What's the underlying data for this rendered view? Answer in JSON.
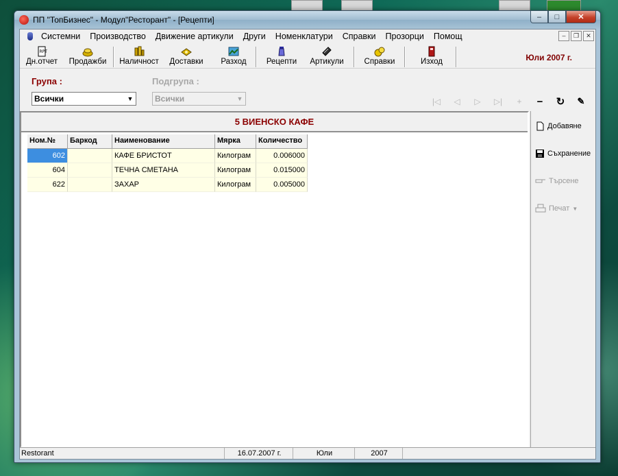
{
  "window": {
    "title": "ПП \"ТопБизнес\" - Модул\"Ресторант\" - [Рецепти]",
    "btn_minimize": "–",
    "btn_maximize": "□",
    "btn_close": "✕"
  },
  "menu": {
    "items": [
      "Системни",
      "Производство",
      "Движение артикули",
      "Други",
      "Номенклатури",
      "Справки",
      "Прозорци",
      "Помощ"
    ]
  },
  "toolbar": {
    "buttons": [
      "Дн.отчет",
      "Продажби",
      "Наличност",
      "Доставки",
      "Разход",
      "Рецепти",
      "Артикули",
      "Справки",
      "Изход"
    ],
    "period": "Юли 2007 г."
  },
  "filters": {
    "group_label": "Група :",
    "group_value": "Всички",
    "subgroup_label": "Подгрупа :",
    "subgroup_value": "Всички"
  },
  "recipe": {
    "title": "5 ВИЕНСКО КАФЕ",
    "columns": [
      "Ном.№",
      "Баркод",
      "Наименование",
      "Мярка",
      "Количество"
    ],
    "rows": [
      {
        "no": "602",
        "barcode": "",
        "name": "КАФЕ БРИСТОТ",
        "unit": "Килограм",
        "qty": "0.006000"
      },
      {
        "no": "604",
        "barcode": "",
        "name": "ТЕЧНА СМЕТАНА",
        "unit": "Килограм",
        "qty": "0.015000"
      },
      {
        "no": "622",
        "barcode": "",
        "name": "ЗАХАР",
        "unit": "Килограм",
        "qty": "0.005000"
      }
    ]
  },
  "side": {
    "add": "Добавяне",
    "save": "Съхранение",
    "search": "Търсене",
    "print": "Печат"
  },
  "status": {
    "app": "Restorant",
    "date": "16.07.2007 г.",
    "month": "Юли",
    "year": "2007"
  },
  "colors": {
    "accent_dark_red": "#8b0000",
    "selection": "#3d8ee0",
    "row_bg": "#ffffe6"
  }
}
